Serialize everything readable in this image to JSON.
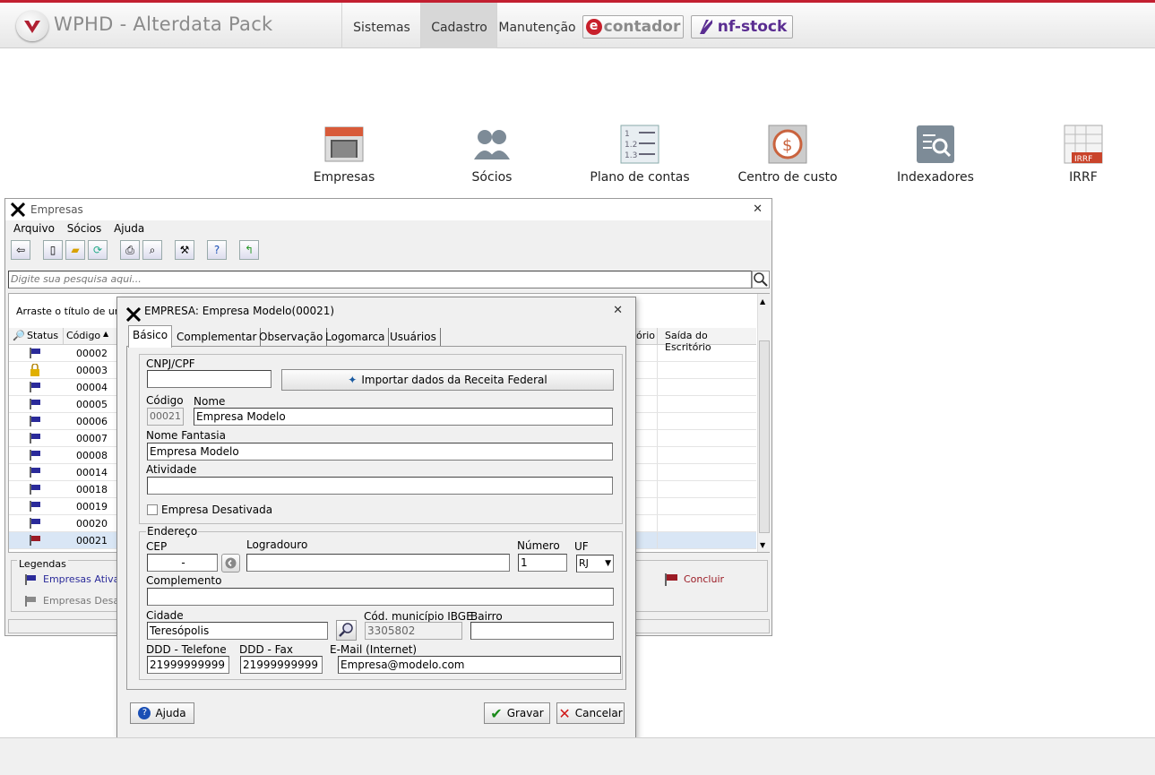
{
  "app": {
    "title": "WPHD - Alterdata Pack"
  },
  "top_menu": [
    "Sistemas",
    "Cadastro",
    "Manutenção"
  ],
  "brand_buttons": {
    "contador": "contador",
    "nfstock": "nf-stock"
  },
  "ribbon": [
    {
      "label": "Empresas",
      "icon": "building-icon"
    },
    {
      "label": "Sócios",
      "icon": "people-icon"
    },
    {
      "label": "Plano de contas",
      "icon": "numbered-list-icon"
    },
    {
      "label": "Centro de custo",
      "icon": "dollar-coin-icon"
    },
    {
      "label": "Indexadores",
      "icon": "magnifier-list-icon"
    },
    {
      "label": "IRRF",
      "icon": "irrf-table-icon"
    }
  ],
  "empresas_window": {
    "title": "Empresas",
    "menu": [
      "Arquivo",
      "Sócios",
      "Ajuda"
    ],
    "search_placeholder": "Digite sua pesquisa aqui...",
    "group_hint": "Arraste o título de uma c",
    "columns": {
      "status": "Status",
      "codigo": "Código",
      "escritorio_partial": "ório",
      "saida": "Saída do Escritório"
    },
    "rows": [
      {
        "codigo": "00002",
        "status": "ativa"
      },
      {
        "codigo": "00003",
        "status": "lock"
      },
      {
        "codigo": "00004",
        "status": "ativa"
      },
      {
        "codigo": "00005",
        "status": "ativa"
      },
      {
        "codigo": "00006",
        "status": "ativa"
      },
      {
        "codigo": "00007",
        "status": "ativa"
      },
      {
        "codigo": "00008",
        "status": "ativa"
      },
      {
        "codigo": "00014",
        "status": "ativa"
      },
      {
        "codigo": "00018",
        "status": "ativa"
      },
      {
        "codigo": "00019",
        "status": "ativa"
      },
      {
        "codigo": "00020",
        "status": "ativa"
      },
      {
        "codigo": "00021",
        "status": "concluida"
      }
    ],
    "legend": {
      "title": "Legendas",
      "ativas": "Empresas Ativas",
      "desativadas": "Empresas Desativ",
      "concluir": "Concluir"
    },
    "colors": {
      "ativa": "#2b2b9a",
      "concluida": "#9b1b25",
      "desativada": "#8a8a8a"
    }
  },
  "dialog": {
    "title": "EMPRESA: Empresa Modelo(00021)",
    "tabs": [
      "Básico",
      "Complementar",
      "Observação",
      "Logomarca",
      "Usuários"
    ],
    "cnpj_label": "CNPJ/CPF",
    "cnpj_value": "",
    "import_button": "Importar dados da Receita Federal",
    "codigo_label": "Código",
    "codigo_value": "00021",
    "nome_label": "Nome",
    "nome_value": "Empresa Modelo",
    "fantasia_label": "Nome Fantasia",
    "fantasia_value": "Empresa Modelo",
    "atividade_label": "Atividade",
    "atividade_value": "",
    "desativada_label": "Empresa Desativada",
    "endereco_label": "Endereço",
    "cep_label": "CEP",
    "cep_value": "-",
    "logradouro_label": "Logradouro",
    "logradouro_value": "",
    "numero_label": "Número",
    "numero_value": "1",
    "uf_label": "UF",
    "uf_value": "RJ",
    "complemento_label": "Complemento",
    "complemento_value": "",
    "cidade_label": "Cidade",
    "cidade_value": "Teresópolis",
    "ibge_label": "Cód. município IBGE",
    "ibge_value": "3305802",
    "bairro_label": "Bairro",
    "bairro_value": "",
    "ddd_tel_label": "DDD - Telefone",
    "ddd_tel_value": "21999999999",
    "ddd_fax_label": "DDD - Fax",
    "ddd_fax_value": "21999999999",
    "email_label": "E-Mail (Internet)",
    "email_value": "Empresa@modelo.com",
    "ajuda_button": "Ajuda",
    "gravar_button": "Gravar",
    "cancelar_button": "Cancelar"
  }
}
